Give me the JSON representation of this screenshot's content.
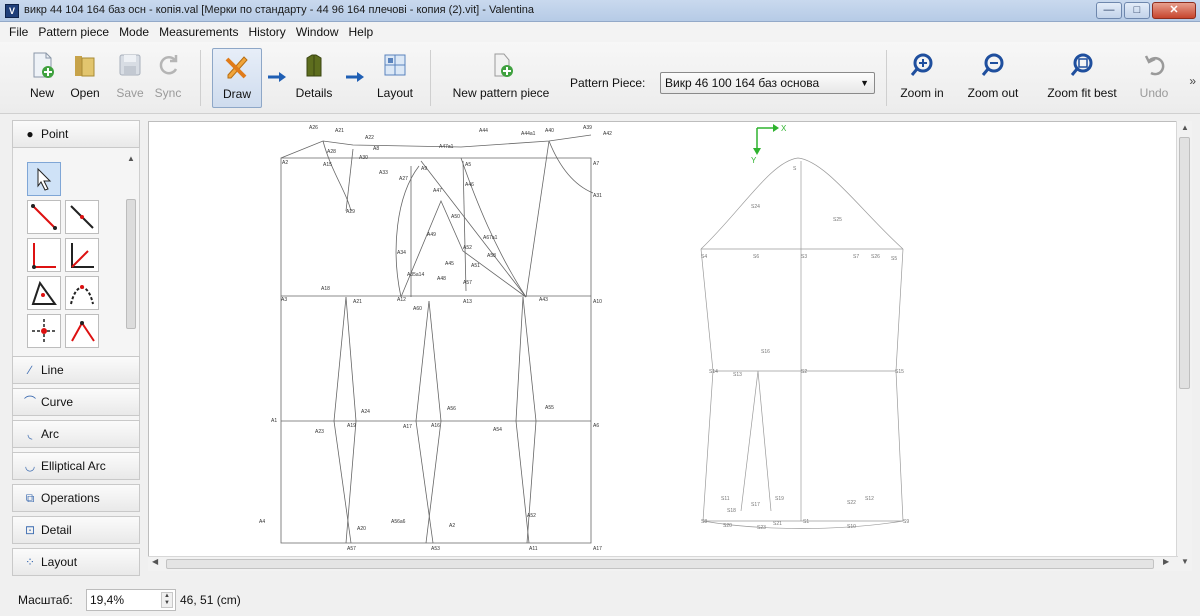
{
  "window": {
    "title": "викр 44 104 164 баз осн - копія.val [Мерки по стандарту - 44 96 164 плечові - копия (2).vit] - Valentina",
    "minimize": "—",
    "maximize": "□",
    "close": "✕"
  },
  "menu": [
    "File",
    "Pattern piece",
    "Mode",
    "Measurements",
    "History",
    "Window",
    "Help"
  ],
  "toolbar": {
    "new": "New",
    "open": "Open",
    "save": "Save",
    "sync": "Sync",
    "draw": "Draw",
    "details": "Details",
    "layout": "Layout",
    "new_pattern_piece": "New pattern piece",
    "pattern_piece_label": "Pattern Piece:",
    "pattern_piece_value": "Викр 46 100 164 баз основа",
    "zoom_in": "Zoom in",
    "zoom_out": "Zoom out",
    "zoom_fit_best": "Zoom fit best",
    "undo": "Undo",
    "more": "»"
  },
  "left_panel": {
    "point": "Point",
    "line": "Line",
    "curve": "Curve",
    "arc": "Arc",
    "elliptical_arc": "Elliptical Arc",
    "operations": "Operations",
    "detail": "Detail",
    "layout": "Layout"
  },
  "canvas": {
    "axis_x": "X",
    "axis_y": "Y",
    "left_labels": [
      "A26",
      "A21",
      "A22",
      "A28",
      "A8",
      "A47a1",
      "A44",
      "A44a1",
      "A40",
      "A39",
      "A42",
      "A2",
      "A15",
      "A30",
      "A33",
      "A27",
      "A9",
      "A5",
      "A7",
      "A31",
      "A29",
      "A47",
      "A46",
      "A50",
      "A49",
      "A67a1",
      "A52",
      "A58",
      "A34",
      "A45",
      "A51",
      "A35a14",
      "A48",
      "A57",
      "A18",
      "A3",
      "A21",
      "A12",
      "A60",
      "A13",
      "A43",
      "A10",
      "A24",
      "A56",
      "A55",
      "A1",
      "A23",
      "A19",
      "A17",
      "A16",
      "A54",
      "A6",
      "A4",
      "A56a6",
      "A2",
      "A20",
      "A57",
      "A53",
      "A52",
      "A11",
      "A17"
    ],
    "right_labels": [
      "S",
      "S24",
      "S25",
      "S4",
      "S6",
      "S3",
      "S7",
      "S26",
      "S5",
      "S16",
      "S14",
      "S13",
      "S2",
      "S15",
      "S11",
      "S17",
      "S19",
      "S22",
      "S12",
      "S8",
      "S18",
      "S20",
      "S23",
      "S21",
      "S1",
      "S10",
      "S9"
    ]
  },
  "status": {
    "scale_label": "Масштаб:",
    "scale_value": "19,4%",
    "coordinates": "46, 51 (cm)"
  },
  "colors": {
    "titlebar": "#b6cbe6",
    "accent_orange": "#e07b1a",
    "accent_blue": "#1f5fb4",
    "axis_green": "#2fb32f",
    "drawing_line": "#555555"
  }
}
